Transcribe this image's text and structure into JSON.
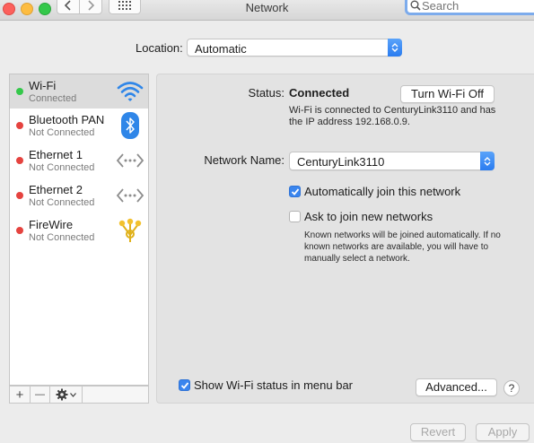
{
  "window": {
    "title": "Network"
  },
  "search": {
    "placeholder": "Search"
  },
  "location": {
    "label": "Location:",
    "value": "Automatic"
  },
  "services": [
    {
      "name": "Wi-Fi",
      "status": "Connected",
      "dot_color": "#34c84a",
      "icon": "wifi-icon",
      "selected": true
    },
    {
      "name": "Bluetooth PAN",
      "status": "Not Connected",
      "dot_color": "#e5433f",
      "icon": "bluetooth-icon",
      "selected": false
    },
    {
      "name": "Ethernet 1",
      "status": "Not Connected",
      "dot_color": "#e5433f",
      "icon": "ethernet-icon",
      "selected": false
    },
    {
      "name": "Ethernet 2",
      "status": "Not Connected",
      "dot_color": "#e5433f",
      "icon": "ethernet-icon",
      "selected": false
    },
    {
      "name": "FireWire",
      "status": "Not Connected",
      "dot_color": "#e5433f",
      "icon": "firewire-icon",
      "selected": false
    }
  ],
  "sidebar_toolbar": {
    "add": "+",
    "remove": "—"
  },
  "detail": {
    "status_label": "Status:",
    "status_value": "Connected",
    "turn_off_button": "Turn Wi-Fi Off",
    "status_description": "Wi-Fi is connected to CenturyLink3110 and has the IP address 192.168.0.9.",
    "network_name_label": "Network Name:",
    "network_name_value": "CenturyLink3110",
    "auto_join_label": "Automatically join this network",
    "auto_join_checked": true,
    "ask_join_label": "Ask to join new networks",
    "ask_join_checked": false,
    "ask_join_description": "Known networks will be joined automatically. If no known networks are available, you will have to manually select a network.",
    "show_status_label": "Show Wi-Fi status in menu bar",
    "show_status_checked": true,
    "advanced_button": "Advanced...",
    "help_button": "?"
  },
  "footer": {
    "revert_button": "Revert",
    "apply_button": "Apply"
  },
  "colors": {
    "accent": "#3a85ee",
    "connected": "#34c84a",
    "disconnected": "#e5433f"
  }
}
